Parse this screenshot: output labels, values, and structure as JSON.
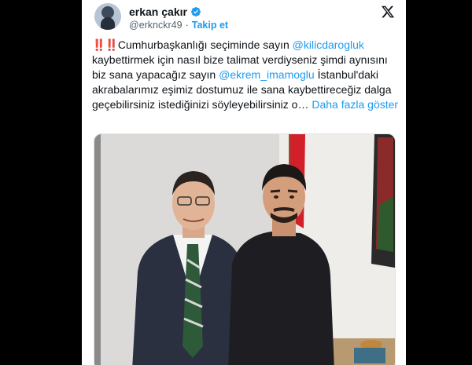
{
  "tweet": {
    "author": {
      "display_name": "erkan çakır",
      "handle": "@erknckr49",
      "verified": true,
      "follow_label": "Takip et",
      "separator": "·"
    },
    "text": {
      "bangs": "‼️‼️",
      "part1": "Cumhurbaşkanlığı seçiminde sayın ",
      "mention1": "@kilicdarogluk",
      "part2": " kaybettirmek için nasıl bize talimat verdiyseniz şimdi aynısını biz sana yapacağız sayın ",
      "mention2": "@ekrem_imamoglu",
      "part3": " İstanbul'daki akrabalarımız eşimiz dostumuz ile sana kaybettireceğiz dalga geçebilirsiniz istediğinizi söyleyebilirsiniz o… ",
      "more": "Daha fazla göster"
    },
    "media": {
      "kind": "photo",
      "description_icon": "two-men-photo"
    },
    "colors": {
      "accent": "#1d9bf0",
      "text": "#0f1419",
      "muted": "#536471",
      "verified": "#1d9bf0"
    }
  }
}
